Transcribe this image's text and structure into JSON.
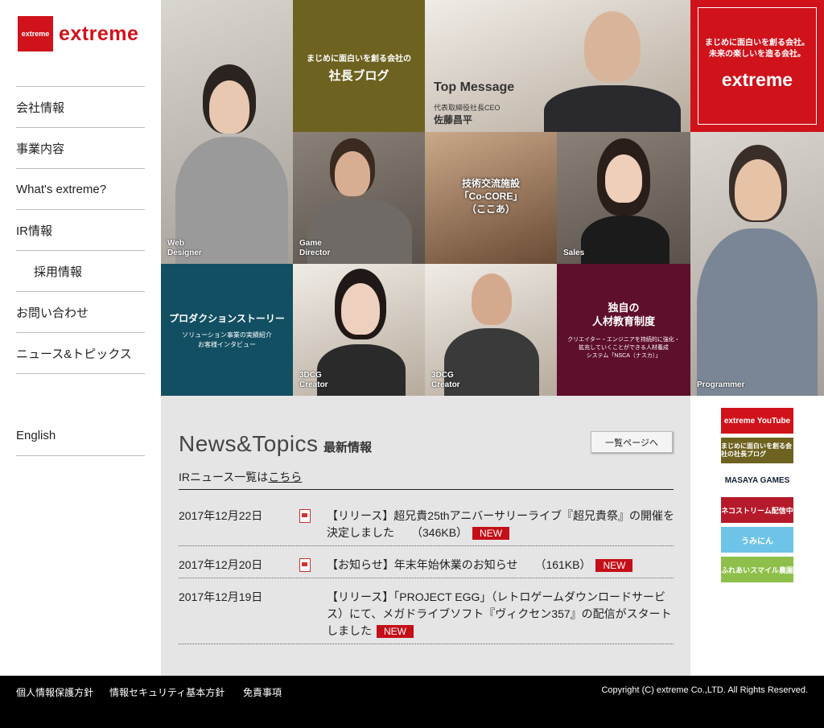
{
  "logo": {
    "box_text": "extreme",
    "text": "extreme"
  },
  "nav": {
    "items": [
      "会社情報",
      "事業内容",
      "What's extreme?",
      "IR情報",
      "採用情報",
      "お問い合わせ",
      "ニュース&トピックス"
    ],
    "english": "English"
  },
  "tiles": {
    "blog_sub": "まじめに面白いを創る会社の",
    "blog_title": "社長ブログ",
    "top_message": "Top Message",
    "ceo_role": "代表取締役社長CEO",
    "ceo_name": "佐藤昌平",
    "brand_tagline": "まじめに面白いを創る会社。\n未来の楽しいを造る会社。",
    "brand_name": "extreme",
    "web_designer": "Web\nDesigner",
    "game_director": "Game\nDirector",
    "facility_title": "技術交流施設\n「Co-CORE」\n（ここあ）",
    "sales": "Sales",
    "programmer": "Programmer",
    "production_title": "プロダクションストーリー",
    "production_sub": "ソリューション事業の実績紹介\nお客様インタビュー",
    "creator1": "3DCG\nCreator",
    "creator2": "3DCG\nCreator",
    "education_title": "独自の\n人材教育制度",
    "education_sub": "クリエイター・エンジニアを持続的に強化・\n拡充していくことができる人材養成\nシステム「NSCA（ナスカ）」"
  },
  "news": {
    "title": "News&Topics",
    "subtitle": "最新情報",
    "list_button": "一覧ページへ",
    "ir_prefix": "IRニュース一覧は",
    "ir_link": "こちら",
    "new_label": "NEW",
    "items": [
      {
        "date": "2017年12月22日",
        "text": "【リリース】超兄貴25thアニバーサリーライブ『超兄貴祭』の開催を決定しました　　（346KB）"
      },
      {
        "date": "2017年12月20日",
        "text": "【お知らせ】年末年始休業のお知らせ　　（161KB）"
      },
      {
        "date": "2017年12月19日",
        "text": "【リリース】「PROJECT EGG」（レトロゲームダウンロードサービス）にて、メガドライブソフト『ヴィクセン357』の配信がスタートしました"
      }
    ]
  },
  "banners": [
    "extreme YouTube",
    "まじめに面白いを創る会社の社長ブログ",
    "MASAYA GAMES",
    "ネコストリーム配信中",
    "うみにん",
    "ふれあいスマイル農園"
  ],
  "footer": {
    "links": [
      "個人情報保護方針",
      "情報セキュリティ基本方針",
      "免責事項"
    ],
    "copyright": "Copyright (C) extreme Co.,LTD. All Rights Reserved."
  },
  "colors": {
    "brand_red": "#d0121b",
    "olive": "#6e6220",
    "teal": "#124f62",
    "maroon": "#5e0f2c"
  }
}
